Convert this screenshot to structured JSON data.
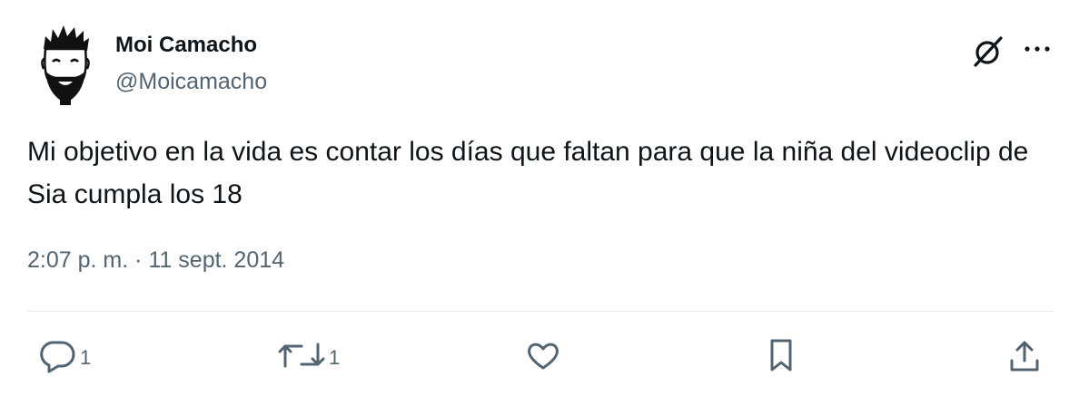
{
  "author": {
    "name": "Moi Camacho",
    "handle": "@Moicamacho"
  },
  "tweet": {
    "text": "Mi objetivo en la vida es contar los días que faltan para que la niña del videoclip de Sia cumpla los 18",
    "timestamp": "2:07 p. m. · 11 sept. 2014"
  },
  "actions": {
    "reply_count": "1",
    "retweet_count": "1"
  },
  "icons": {
    "header": [
      "grok-icon",
      "more-options-icon"
    ],
    "actions": [
      "reply-icon",
      "retweet-icon",
      "like-icon",
      "bookmark-icon",
      "share-icon"
    ]
  },
  "colors": {
    "text": "#0f1419",
    "secondary": "#536471",
    "divider": "#e6ecf0"
  }
}
